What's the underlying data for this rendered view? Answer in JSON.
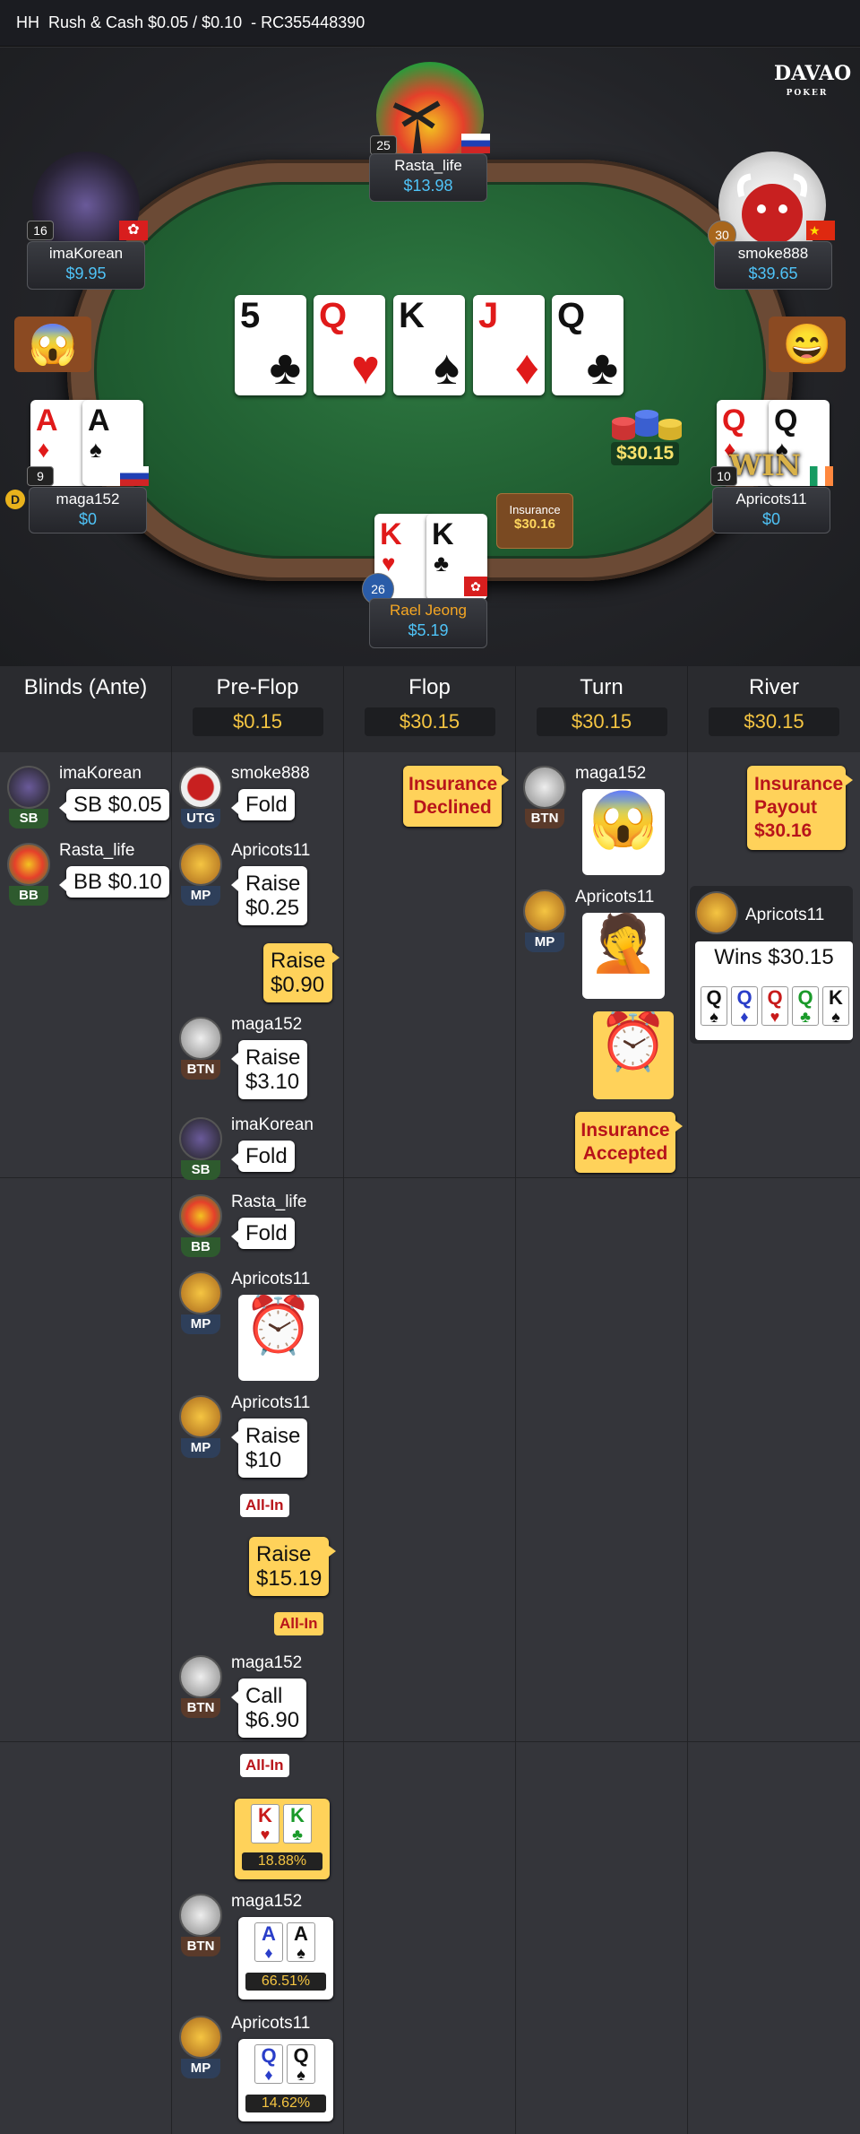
{
  "header": {
    "type": "HH",
    "game": "Rush & Cash $0.05 / $0.10",
    "hand_id": "- RC355448390"
  },
  "logo": {
    "top": "DAVAO",
    "bottom": "POKER"
  },
  "board": [
    {
      "rank": "5",
      "suit": "♣",
      "color": "#111"
    },
    {
      "rank": "Q",
      "suit": "♥",
      "color": "#e01a1a"
    },
    {
      "rank": "K",
      "suit": "♠",
      "color": "#111"
    },
    {
      "rank": "J",
      "suit": "♦",
      "color": "#e01a1a"
    },
    {
      "rank": "Q",
      "suit": "♣",
      "color": "#111"
    }
  ],
  "pot": "$30.15",
  "insurance_chip": {
    "label": "Insurance",
    "amount": "$30.16"
  },
  "seats": {
    "rasta": {
      "name": "Rasta_life",
      "stack": "$13.98",
      "level": "25"
    },
    "imakorean": {
      "name": "imaKorean",
      "stack": "$9.95",
      "level": "16"
    },
    "smoke": {
      "name": "smoke888",
      "stack": "$39.65",
      "level": "30"
    },
    "maga": {
      "name": "maga152",
      "stack": "$0",
      "level": "9",
      "cards": [
        {
          "rank": "A",
          "suit": "♦",
          "color": "#e01a1a"
        },
        {
          "rank": "A",
          "suit": "♠",
          "color": "#111"
        }
      ]
    },
    "apricots": {
      "name": "Apricots11",
      "stack": "$0",
      "level": "10",
      "cards": [
        {
          "rank": "Q",
          "suit": "♦",
          "color": "#e01a1a"
        },
        {
          "rank": "Q",
          "suit": "♠",
          "color": "#111"
        }
      ],
      "win_label": "WIN"
    },
    "hero": {
      "name": "Rael Jeong",
      "stack": "$5.19",
      "level": "26",
      "cards": [
        {
          "rank": "K",
          "suit": "♥",
          "color": "#e01a1a"
        },
        {
          "rank": "K",
          "suit": "♣",
          "color": "#111"
        }
      ]
    }
  },
  "columns": [
    {
      "title": "Blinds (Ante)",
      "pot": ""
    },
    {
      "title": "Pre-Flop",
      "pot": "$0.15"
    },
    {
      "title": "Flop",
      "pot": "$30.15"
    },
    {
      "title": "Turn",
      "pot": "$30.15"
    },
    {
      "title": "River",
      "pot": "$30.15"
    }
  ],
  "blinds": [
    {
      "name": "imaKorean",
      "pos": "SB",
      "action": "SB $0.05"
    },
    {
      "name": "Rasta_life",
      "pos": "BB",
      "action": "BB $0.10"
    }
  ],
  "preflop": {
    "a1": {
      "name": "smoke888",
      "pos": "UTG",
      "action": "Fold"
    },
    "a2": {
      "name": "Apricots11",
      "pos": "MP",
      "action1": "Raise",
      "action2": "$0.25"
    },
    "hero1": {
      "l1": "Raise",
      "l2": "$0.90"
    },
    "a3": {
      "name": "maga152",
      "pos": "BTN",
      "action1": "Raise",
      "action2": "$3.10"
    },
    "a4": {
      "name": "imaKorean",
      "pos": "SB",
      "action": "Fold"
    },
    "a5": {
      "name": "Rasta_life",
      "pos": "BB",
      "action": "Fold"
    },
    "a6": {
      "name": "Apricots11",
      "pos": "MP"
    },
    "a7": {
      "name": "Apricots11",
      "pos": "MP",
      "action1": "Raise",
      "action2": "$10",
      "allin": "All-In"
    },
    "hero2": {
      "l1": "Raise",
      "l2": "$15.19",
      "allin": "All-In"
    },
    "a8": {
      "name": "maga152",
      "pos": "BTN",
      "action1": "Call",
      "action2": "$6.90",
      "allin": "All-In"
    },
    "hero_show": {
      "c1r": "K",
      "c1s": "♥",
      "c2r": "K",
      "c2s": "♣",
      "eq": "18.88%"
    },
    "maga_show": {
      "name": "maga152",
      "pos": "BTN",
      "c1r": "A",
      "c1s": "♦",
      "c2r": "A",
      "c2s": "♠",
      "eq": "66.51%"
    },
    "apri_show": {
      "name": "Apricots11",
      "pos": "MP",
      "c1r": "Q",
      "c1s": "♦",
      "c2r": "Q",
      "c2s": "♠",
      "eq": "14.62%"
    }
  },
  "flop": {
    "insurance": {
      "l1": "Insurance",
      "l2": "Declined"
    }
  },
  "turn": {
    "t1": {
      "name": "maga152",
      "pos": "BTN"
    },
    "t2": {
      "name": "Apricots11",
      "pos": "MP"
    },
    "insurance": {
      "l1": "Insurance",
      "l2": "Accepted"
    }
  },
  "river": {
    "insurance": {
      "l1": "Insurance",
      "l2": "Payout",
      "l3": "$30.16"
    },
    "winner": {
      "name": "Apricots11",
      "text": "Wins $30.15",
      "cards": [
        {
          "r": "Q",
          "s": "♠",
          "c": "#111"
        },
        {
          "r": "Q",
          "s": "♦",
          "c": "#2a3ec9"
        },
        {
          "r": "Q",
          "s": "♥",
          "c": "#c81a1a"
        },
        {
          "r": "Q",
          "s": "♣",
          "c": "#1a9a2a"
        },
        {
          "r": "K",
          "s": "♠",
          "c": "#111"
        }
      ]
    }
  }
}
